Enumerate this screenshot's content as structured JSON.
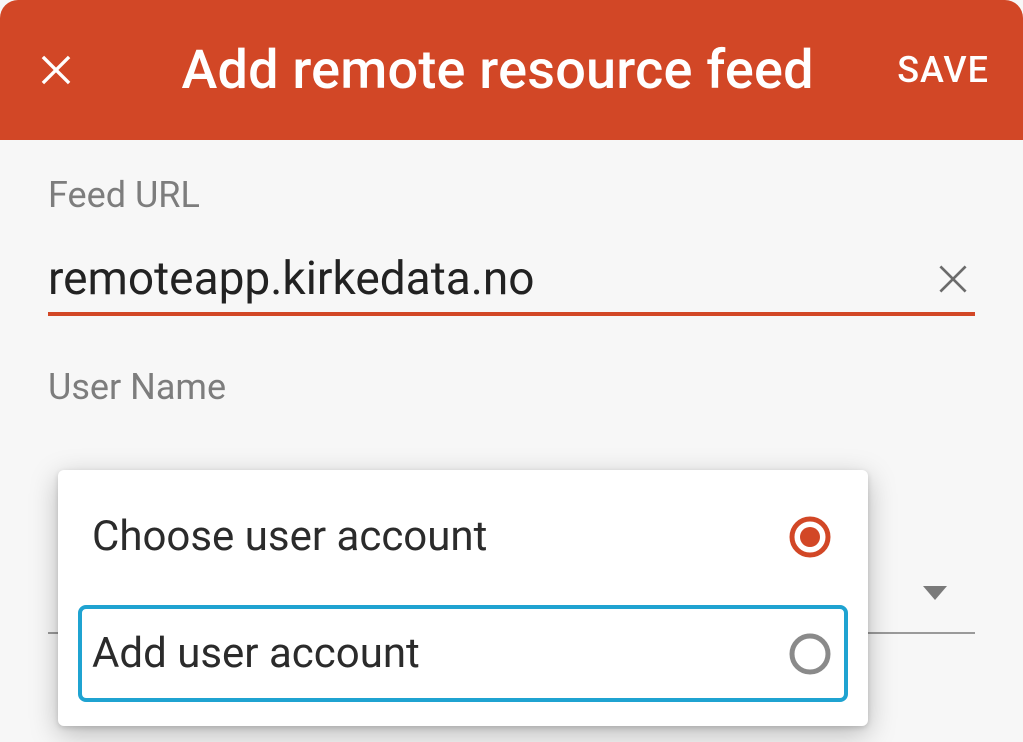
{
  "appbar": {
    "title": "Add remote resource feed",
    "save_label": "SAVE"
  },
  "form": {
    "feed_url_label": "Feed URL",
    "feed_url_value": "remoteapp.kirkedata.no",
    "user_name_label": "User Name"
  },
  "user_dropdown": {
    "options": [
      {
        "label": "Choose user account",
        "selected": true,
        "highlight": false
      },
      {
        "label": "Add user account",
        "selected": false,
        "highlight": true
      }
    ]
  },
  "colors": {
    "accent": "#d24726",
    "highlight_border": "#1fa3d1"
  }
}
